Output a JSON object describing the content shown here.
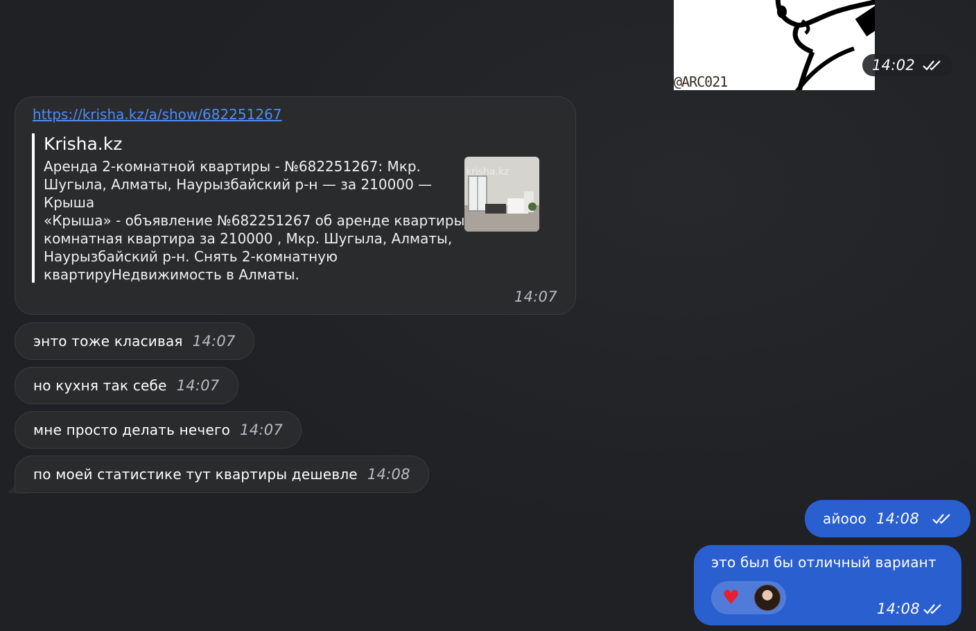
{
  "sticker": {
    "credit": "@ARC021",
    "time": "14:02",
    "status_icon": "double-check-icon"
  },
  "messages": {
    "link_preview": {
      "url": "https://krisha.kz/a/show/682251267",
      "site_name": "Krisha.kz",
      "title": "Аренда 2-комнатной квартиры - №682251267: Мкр. Шугыла, Алматы, Наурызбайский р-н — за 210000 — Крыша",
      "description": "«Крыша» - объявление №682251267 об аренде квартиры: 2-комнатная квартира за 210000 , Мкр. Шугыла, Алматы, Наурызбайский р-н. Снять 2-комнатную квартируНедвижимость в Алматы.",
      "thumbnail_watermark": "krisha.kz",
      "time": "14:07"
    },
    "incoming": [
      {
        "text": "энто тоже класивая",
        "time": "14:07"
      },
      {
        "text": "но кухня так себе",
        "time": "14:07"
      },
      {
        "text": "мне просто делать нечего",
        "time": "14:07"
      },
      {
        "text": "по моей статистике тут квартиры дешевле",
        "time": "14:08"
      }
    ],
    "outgoing": [
      {
        "text": "айооо",
        "time": "14:08",
        "status_icon": "double-check-icon"
      },
      {
        "text": "это был бы отличный вариант",
        "time": "14:08",
        "status_icon": "double-check-icon",
        "reactions": [
          {
            "emoji": "♥",
            "icon": "heart-reaction-icon"
          },
          {
            "icon": "avatar-reaction"
          }
        ]
      }
    ]
  },
  "colors": {
    "background": "#1f2124",
    "incoming_bubble": "#2a2b2d",
    "outgoing_bubble": "#2a5fd0",
    "link": "#4f8df5",
    "heart": "#e8202e"
  }
}
